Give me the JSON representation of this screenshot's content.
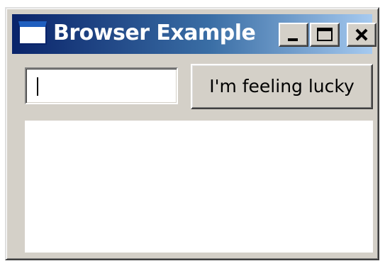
{
  "window": {
    "title": "Browser Example",
    "icon": "app-window-icon",
    "controls": {
      "minimize_icon": "minimize-icon",
      "maximize_icon": "maximize-icon",
      "close_icon": "close-icon"
    }
  },
  "toolbar": {
    "url_input": {
      "value": "",
      "placeholder": ""
    },
    "lucky_button_label": "I'm feeling lucky"
  },
  "colors": {
    "titlebar_start": "#0a246a",
    "titlebar_end": "#a6caf0",
    "window_face": "#d4d0c8",
    "content_bg": "#ffffff"
  }
}
